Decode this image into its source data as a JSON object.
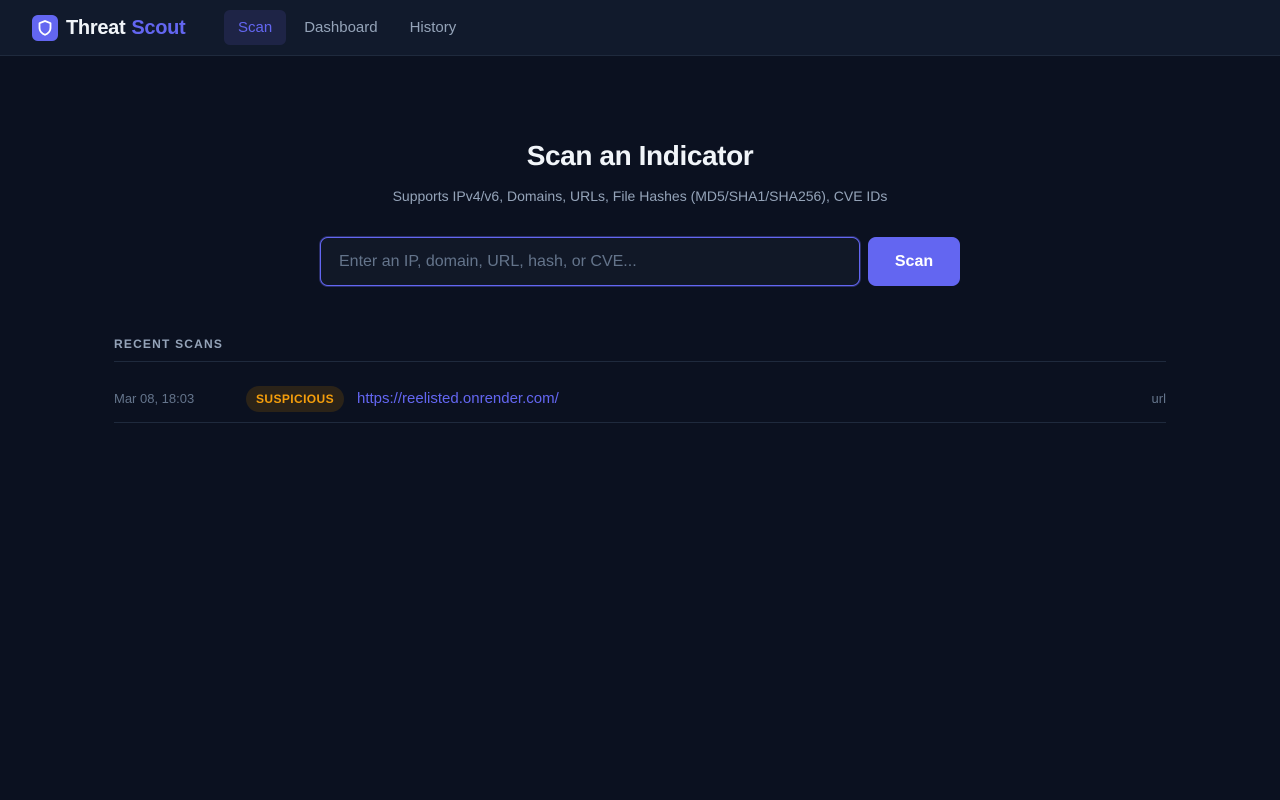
{
  "app": {
    "brand_word1": "Threat",
    "brand_word2": "Scout",
    "logo_icon": "shield-icon",
    "accent_color": "#6366f1"
  },
  "nav": {
    "items": [
      {
        "label": "Scan",
        "active": true
      },
      {
        "label": "Dashboard",
        "active": false
      },
      {
        "label": "History",
        "active": false
      }
    ]
  },
  "hero": {
    "title": "Scan an Indicator",
    "subtitle": "Supports IPv4/v6, Domains, URLs, File Hashes (MD5/SHA1/SHA256), CVE IDs"
  },
  "search": {
    "placeholder": "Enter an IP, domain, URL, hash, or CVE...",
    "value": "",
    "button_label": "Scan"
  },
  "recent": {
    "heading": "RECENT SCANS",
    "rows": [
      {
        "time": "Mar 08, 18:03",
        "verdict": "SUSPICIOUS",
        "verdict_color": "#f59e0b",
        "indicator": "https://reelisted.onrender.com/",
        "type": "url"
      }
    ]
  }
}
